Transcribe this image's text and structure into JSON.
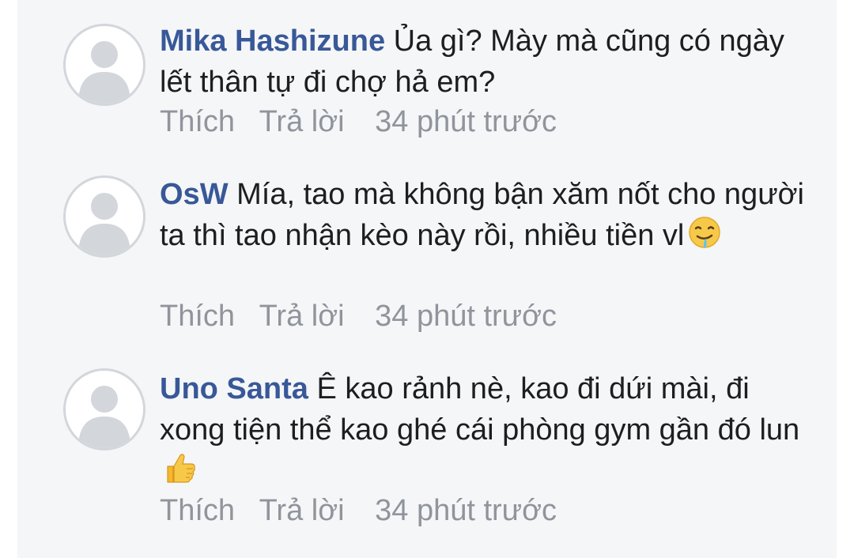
{
  "comments": [
    {
      "author": "Mika Hashizune",
      "text": "Ủa gì? Mày mà cũng có ngày lết thân tự đi chợ hả em?",
      "emoji": "",
      "like": "Thích",
      "reply": "Trả lời",
      "time": "34 phút trước"
    },
    {
      "author": "OsW",
      "text": "Mía, tao mà không bận xăm nốt cho người ta thì tao nhận kèo này rồi, nhiều tiền vl",
      "emoji": "drooling-face",
      "like": "Thích",
      "reply": "Trả lời",
      "time": "34 phút trước"
    },
    {
      "author": "Uno Santa",
      "text": "Ê kao rảnh nè, kao đi dứi mài, đi xong tiện thể kao ghé cái phòng gym gần đó lun",
      "emoji": "thumbs-up",
      "like": "Thích",
      "reply": "Trả lời",
      "time": "34 phút trước"
    }
  ],
  "colors": {
    "author": "#385898",
    "text": "#1c1e21",
    "meta": "#90949c",
    "panel": "#f5f6f7"
  }
}
